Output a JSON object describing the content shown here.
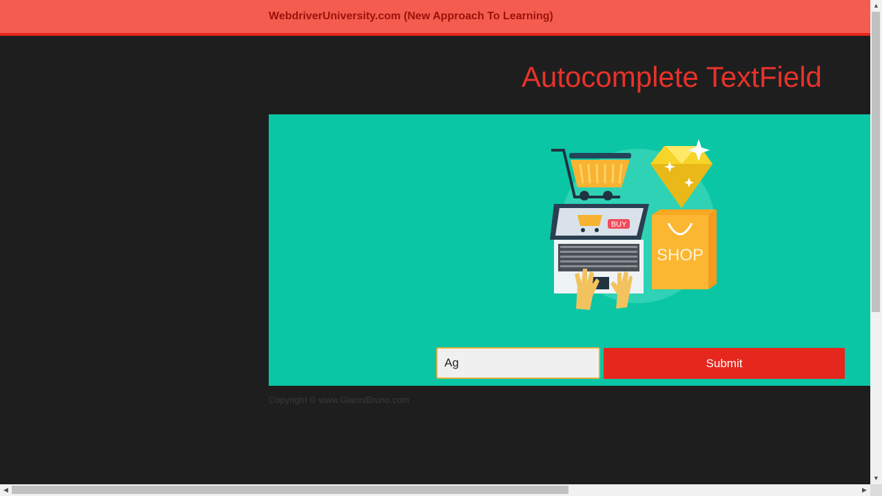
{
  "navbar": {
    "brand": "WebdriverUniversity.com (New Approach To Learning)"
  },
  "page": {
    "title": "Autocomplete TextField"
  },
  "form": {
    "input_value": "Ag",
    "submit_label": "Submit"
  },
  "illustration": {
    "buy_label": "BUY",
    "shop_label": "SHOP"
  },
  "footer": {
    "copyright": "Copyright © www.GianniBruno.com"
  },
  "colors": {
    "navbar": "#f55c50",
    "accent_red": "#e5271e",
    "panel": "#0ac6a5",
    "background": "#1e1e1e"
  }
}
